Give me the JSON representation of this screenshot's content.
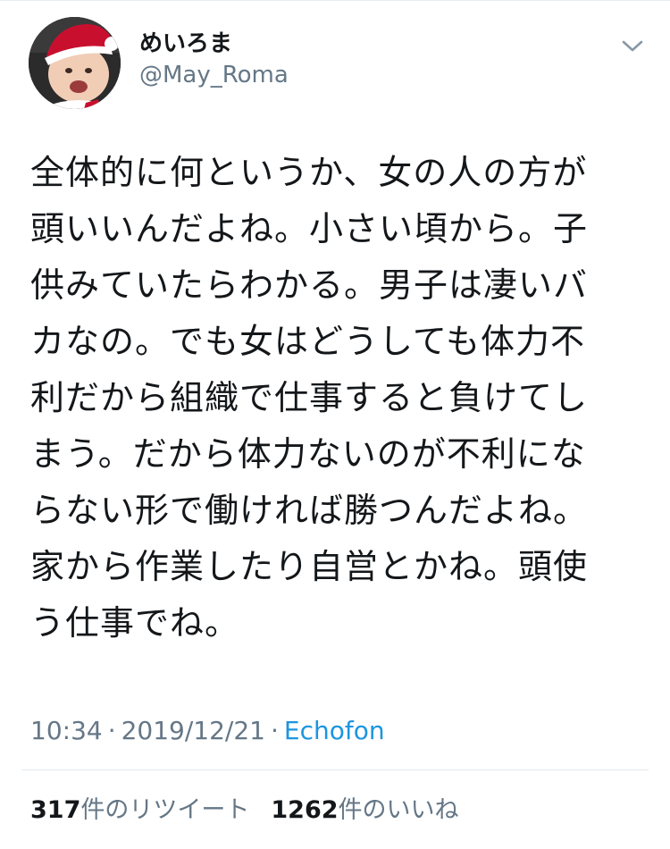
{
  "author": {
    "display_name": "めいろま",
    "username": "@May_Roma",
    "avatar_icon": "baby-santa-hat-avatar"
  },
  "menu_icon": "chevron-down-icon",
  "tweet": {
    "lines": [
      "全体的に何というか、女の人の方が",
      "頭いいんだよね。小さい頃から。子",
      "供みていたらわかる。男子は凄いバ",
      "カなの。でも女はどうしても体力不",
      "利だから組織で仕事すると負けてし",
      "まう。だから体力ないのが不利にな",
      "らない形で働ければ勝つんだよね。",
      "家から作業したり自営とかね。頭使",
      "う仕事でね。"
    ]
  },
  "meta": {
    "time": "10:34",
    "separator": "·",
    "date": "2019/12/21",
    "source": "Echofon"
  },
  "stats": {
    "retweet_count": "317",
    "retweet_label": "件のリツイート",
    "like_count": "1262",
    "like_label": "件のいいね"
  },
  "colors": {
    "text": "#14171a",
    "secondary": "#657786",
    "link": "#1b95e0",
    "divider": "#e1e8ed"
  }
}
